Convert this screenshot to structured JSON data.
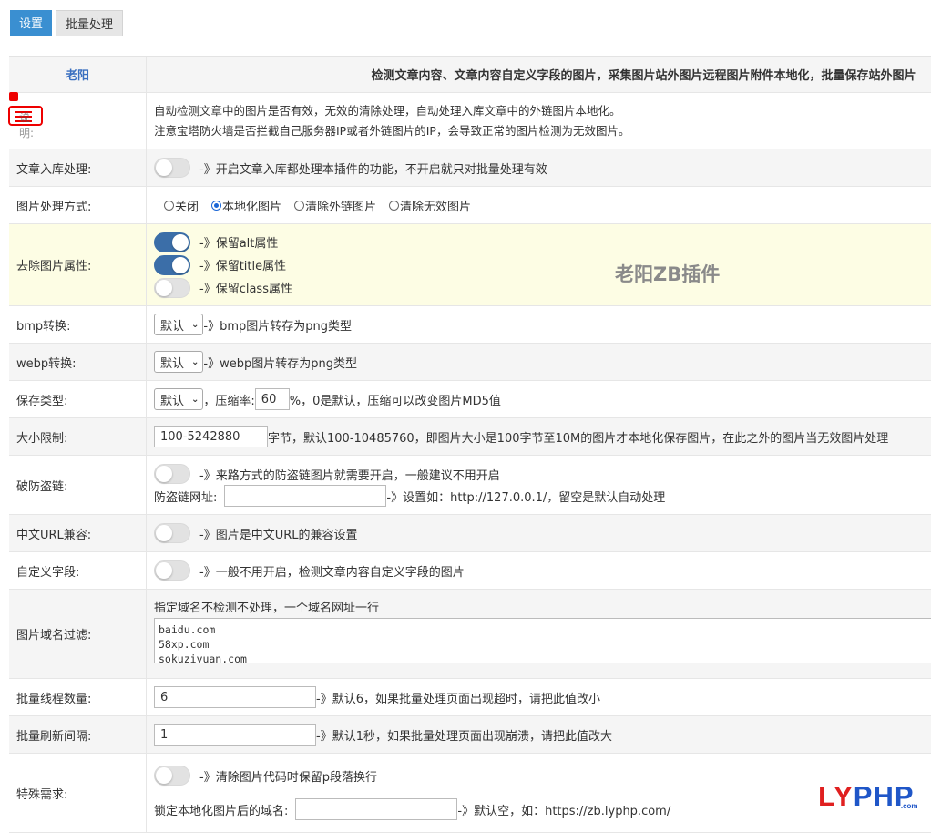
{
  "tabs": [
    {
      "label": "设置",
      "active": true
    },
    {
      "label": "批量处理",
      "active": false
    }
  ],
  "header": {
    "author": "老阳",
    "description": "检测文章内容、文章内容自定义字段的图片，采集图片站外图片远程图片附件本地化，批量保存站外图片"
  },
  "intro": {
    "label": "说明:",
    "line1": "自动检测文章中的图片是否有效，无效的清除处理，自动处理入库文章中的外链图片本地化。",
    "line2": "注意宝塔防火墙是否拦截自己服务器IP或者外链图片的IP，会导致正常的图片检测为无效图片。"
  },
  "article_import": {
    "label": "文章入库处理:",
    "on": false,
    "desc": "-》开启文章入库都处理本插件的功能，不开启就只对批量处理有效"
  },
  "image_mode": {
    "label": "图片处理方式:",
    "options": [
      {
        "label": "关闭",
        "checked": false
      },
      {
        "label": "本地化图片",
        "checked": true
      },
      {
        "label": "清除外链图片",
        "checked": false
      },
      {
        "label": "清除无效图片",
        "checked": false
      }
    ]
  },
  "remove_attrs": {
    "label": "去除图片属性:",
    "items": [
      {
        "on": true,
        "desc": "-》保留alt属性"
      },
      {
        "on": true,
        "desc": "-》保留title属性"
      },
      {
        "on": false,
        "desc": "-》保留class属性"
      }
    ]
  },
  "watermark": "老阳ZB插件",
  "bmp": {
    "label": "bmp转换:",
    "value": "默认",
    "desc": "-》bmp图片转存为png类型"
  },
  "webp": {
    "label": "webp转换:",
    "value": "默认",
    "desc": "-》webp图片转存为png类型"
  },
  "save_type": {
    "label": "保存类型:",
    "value": "默认",
    "compress_label": "，压缩率:",
    "compress_value": "60",
    "desc": "%，0是默认，压缩可以改变图片MD5值"
  },
  "size_limit": {
    "label": "大小限制:",
    "value": "100-5242880",
    "desc": "字节，默认100-10485760，即图片大小是100字节至10M的图片才本地化保存图片，在此之外的图片当无效图片处理"
  },
  "anti_leech": {
    "label": "破防盗链:",
    "on": false,
    "desc": "-》来路方式的防盗链图片就需要开启，一般建议不用开启",
    "url_label": "防盗链网址:",
    "url_value": "",
    "url_desc": "-》设置如：http://127.0.0.1/，留空是默认自动处理"
  },
  "cn_url": {
    "label": "中文URL兼容:",
    "on": false,
    "desc": "-》图片是中文URL的兼容设置"
  },
  "custom_field": {
    "label": "自定义字段:",
    "on": false,
    "desc": "-》一般不用开启，检测文章内容自定义字段的图片"
  },
  "domain_filter": {
    "label": "图片域名过滤:",
    "hint": "指定域名不检测不处理，一个域名网址一行",
    "text": "baidu.com\n58xp.com\nsokuziyuan.com"
  },
  "thread_count": {
    "label": "批量线程数量:",
    "value": "6",
    "desc": "-》默认6，如果批量处理页面出现超时，请把此值改小"
  },
  "refresh_interval": {
    "label": "批量刷新间隔:",
    "value": "1",
    "desc": "-》默认1秒，如果批量处理页面出现崩溃，请把此值改大"
  },
  "special": {
    "label": "特殊需求:",
    "on": false,
    "desc": "-》清除图片代码时保留p段落换行",
    "domain_label": "锁定本地化图片后的域名:",
    "domain_value": "",
    "domain_desc": "-》默认空，如：https://zb.lyphp.com/"
  },
  "logo": {
    "red": "LY",
    "blue": "PHP",
    "suffix": ".com"
  },
  "colors": {
    "accent": "#3a8fd1",
    "switch_on": "#3b6ea8",
    "highlight_row": "#fdfde4",
    "logo_red": "#e02020",
    "logo_blue": "#1f56c8"
  }
}
